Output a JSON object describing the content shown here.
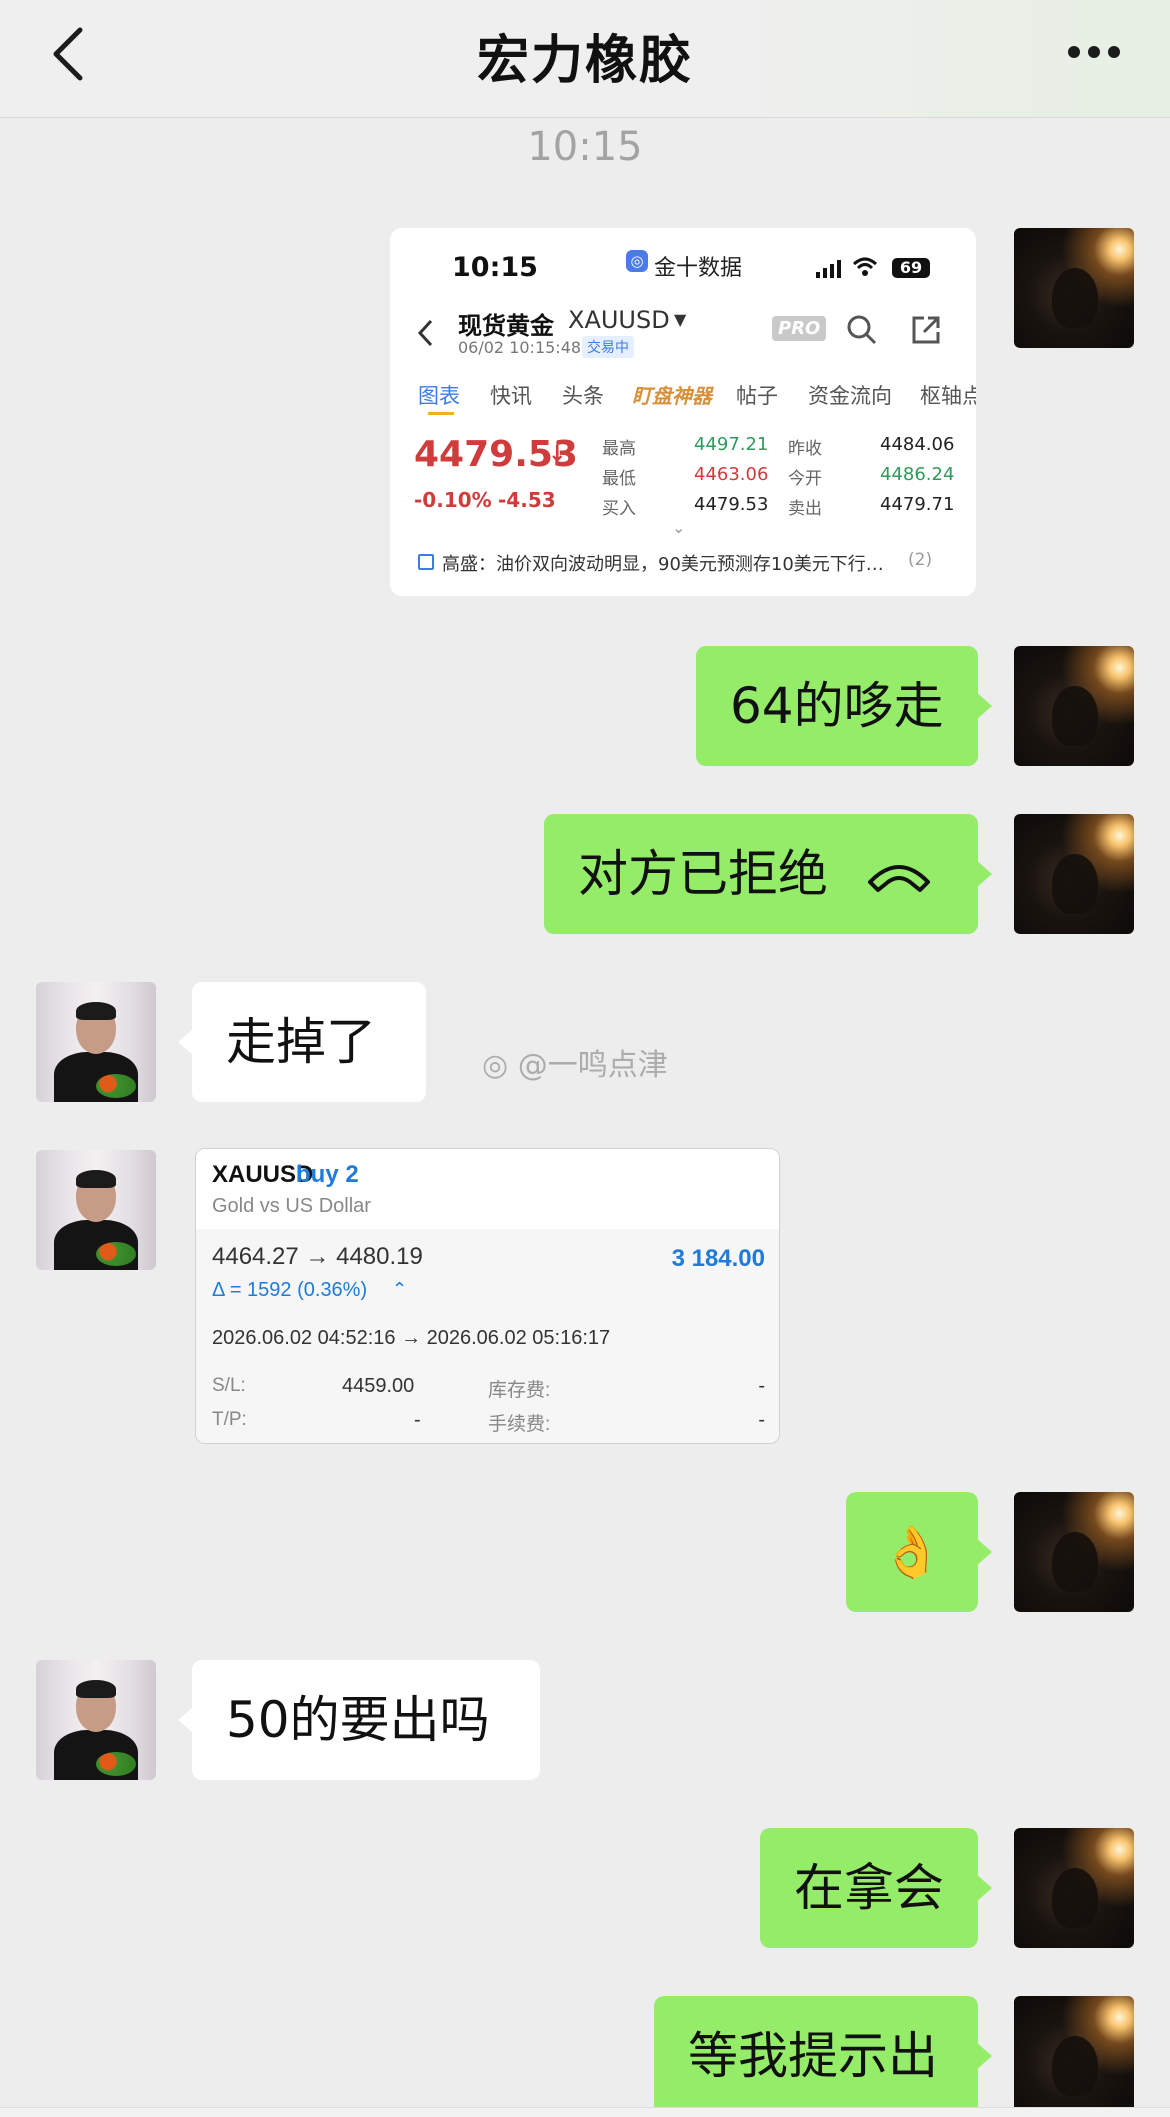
{
  "header": {
    "title": "宏力橡胶"
  },
  "timestamp": "10:15",
  "quote_image": {
    "status_time": "10:15",
    "app_label": "金十数据",
    "battery": "69",
    "instrument_name": "现货黄金",
    "symbol": "XAUUSD",
    "datetime": "06/02 10:15:48",
    "trade_status": "交易中",
    "pro_badge": "PRO",
    "tabs": [
      "图表",
      "快讯",
      "头条",
      "盯盘神器",
      "帖子",
      "资金流向",
      "枢轴点"
    ],
    "price": "4479.53",
    "change_pct": "-0.10%",
    "change_abs": "-4.53",
    "stats": [
      {
        "label": "最高",
        "value": "4497.21"
      },
      {
        "label": "昨收",
        "value": "4484.06"
      },
      {
        "label": "最低",
        "value": "4463.06"
      },
      {
        "label": "今开",
        "value": "4486.24"
      },
      {
        "label": "买入",
        "value": "4479.53"
      },
      {
        "label": "卖出",
        "value": "4479.71"
      }
    ],
    "news": "高盛：油价双向波动明显，90美元预测存10美元下行…",
    "news_count": "(2)",
    "colors": {
      "down": "#d03c3c",
      "up": "#2f9a5b",
      "tab_active": "#3b7de0"
    }
  },
  "messages": [
    {
      "side": "me",
      "text": "64的哆走"
    },
    {
      "side": "me",
      "text": "对方已拒绝"
    },
    {
      "side": "other",
      "text": "走掉了"
    },
    {
      "side": "me",
      "text": "👌"
    },
    {
      "side": "other",
      "text": "50的要出吗"
    },
    {
      "side": "me",
      "text": "在拿会"
    },
    {
      "side": "me",
      "text": "等我提示出"
    }
  ],
  "watermark": "@一鸣点津",
  "trade_card": {
    "symbol": "XAUUSD",
    "side": "buy 2",
    "description": "Gold vs US Dollar",
    "prices": "4464.27 → 4480.19",
    "profit": "3 184.00",
    "delta": "Δ = 1592 (0.36%)",
    "time_range": "2026.06.02 04:52:16 → 2026.06.02 05:16:17",
    "sl_label": "S/L:",
    "sl_value": "4459.00",
    "swap_label": "库存费:",
    "swap_value": "-",
    "tp_label": "T/P:",
    "tp_value": "-",
    "fee_label": "手续费:",
    "fee_value": "-",
    "colors": {
      "profit": "#1f7ad8",
      "header_bg": "#ffffff",
      "body_bg": "#f6f6f6"
    }
  }
}
